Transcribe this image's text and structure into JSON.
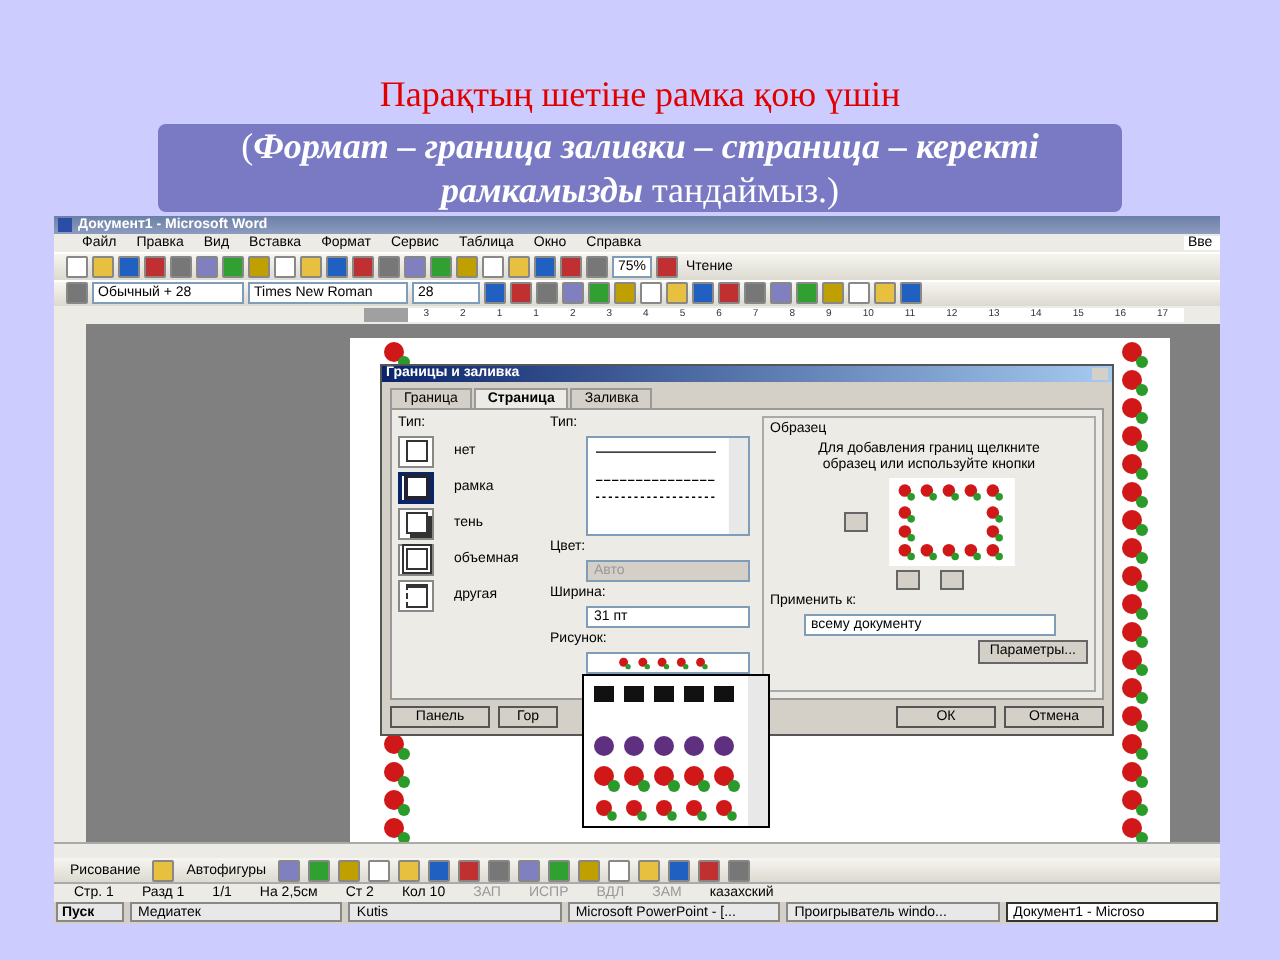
{
  "slide": {
    "title": "Парақтың шетіне рамка қою үшін",
    "instruction": "(**Формат – граница заливки – страница – керекті рамкамызды** тандаймыз.)"
  },
  "word": {
    "title": "Документ1 - Microsoft Word",
    "menu": [
      "Файл",
      "Правка",
      "Вид",
      "Вставка",
      "Формат",
      "Сервис",
      "Таблица",
      "Окно",
      "Справка"
    ],
    "help_box": "Вве",
    "standard_toolbar": {
      "zoom": "75%",
      "read_button": "Чтение"
    },
    "format_toolbar": {
      "style": "Обычный + 28",
      "font": "Times New Roman",
      "size": "28"
    },
    "ruler": [
      "3",
      "2",
      "1",
      "1",
      "2",
      "3",
      "4",
      "5",
      "6",
      "7",
      "8",
      "9",
      "10",
      "11",
      "12",
      "13",
      "14",
      "15",
      "16",
      "17"
    ],
    "drawing_toolbar": {
      "draw_menu": "Рисование",
      "autoshapes_menu": "Автофигуры"
    },
    "status_bar": [
      {
        "text": "Стр. 1",
        "disabled": false
      },
      {
        "text": "Разд 1",
        "disabled": false
      },
      {
        "text": "1/1",
        "disabled": false
      },
      {
        "text": "На 2,5см",
        "disabled": false
      },
      {
        "text": "Ст 2",
        "disabled": false
      },
      {
        "text": "Кол 10",
        "disabled": false
      },
      {
        "text": "ЗАП",
        "disabled": true
      },
      {
        "text": "ИСПР",
        "disabled": true
      },
      {
        "text": "ВДЛ",
        "disabled": true
      },
      {
        "text": "ЗАМ",
        "disabled": true
      },
      {
        "text": "казахский",
        "disabled": false
      }
    ]
  },
  "dialog": {
    "title": "Границы и заливка",
    "tabs": [
      {
        "label": "Граница",
        "selected": false
      },
      {
        "label": "Страница",
        "selected": true
      },
      {
        "label": "Заливка",
        "selected": false
      }
    ],
    "setting_label": "Тип:",
    "settings": [
      {
        "label": "нет",
        "selected": false
      },
      {
        "label": "рамка",
        "selected": true
      },
      {
        "label": "тень",
        "selected": false
      },
      {
        "label": "объемная",
        "selected": false
      },
      {
        "label": "другая",
        "selected": false
      }
    ],
    "style_label": "Тип:",
    "color_label": "Цвет:",
    "color_value": "Авто",
    "color_disabled": true,
    "width_label": "Ширина:",
    "width_value": "31 пт",
    "art_label": "Рисунок:",
    "art_expanded": true,
    "preview_label": "Образец",
    "preview_hint": "Для добавления границ щелкните образец или используйте кнопки",
    "apply_label": "Применить к:",
    "apply_value": "всему документу",
    "options_button": "Параметры...",
    "buttons": [
      "Панель",
      "Гор",
      "ОК",
      "Отмена"
    ]
  },
  "taskbar": {
    "start": "Пуск",
    "items": [
      {
        "label": "Медиатек",
        "selected": false
      },
      {
        "label": "Kutis",
        "selected": false
      },
      {
        "label": "Microsoft PowerPoint - [...",
        "selected": false
      },
      {
        "label": "Проигрыватель windo...",
        "selected": false
      },
      {
        "label": "Документ1 - Microso",
        "selected": true
      }
    ]
  }
}
